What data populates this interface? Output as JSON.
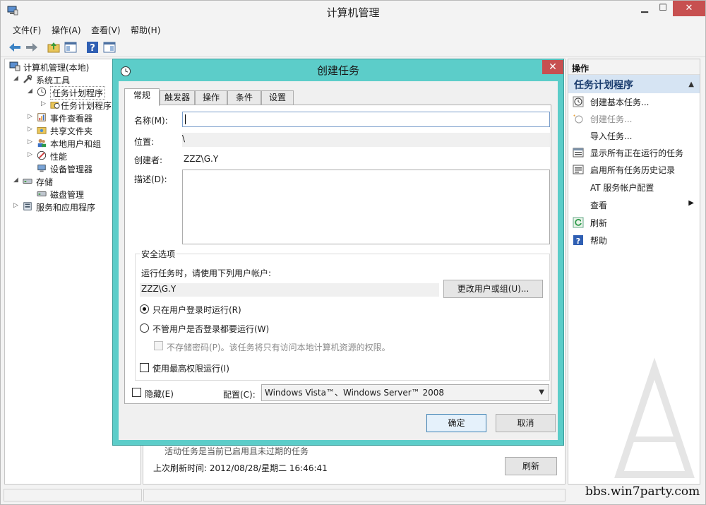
{
  "window": {
    "title": "计算机管理"
  },
  "menu": [
    "文件(F)",
    "操作(A)",
    "查看(V)",
    "帮助(H)"
  ],
  "tree": {
    "items": [
      {
        "label": "计算机管理(本地)",
        "arrow": "",
        "level": 0
      },
      {
        "label": "系统工具",
        "arrow": "◢",
        "level": 1
      },
      {
        "label": "任务计划程序",
        "arrow": "◢",
        "level": 2
      },
      {
        "label": "任务计划程序",
        "arrow": "▷",
        "level": 3
      },
      {
        "label": "事件查看器",
        "arrow": "▷",
        "level": 2
      },
      {
        "label": "共享文件夹",
        "arrow": "▷",
        "level": 2
      },
      {
        "label": "本地用户和组",
        "arrow": "▷",
        "level": 2
      },
      {
        "label": "性能",
        "arrow": "▷",
        "level": 2
      },
      {
        "label": "设备管理器",
        "arrow": "",
        "level": 2
      },
      {
        "label": "存储",
        "arrow": "◢",
        "level": 1
      },
      {
        "label": "磁盘管理",
        "arrow": "",
        "level": 2
      },
      {
        "label": "服务和应用程序",
        "arrow": "▷",
        "level": 1
      }
    ]
  },
  "center": {
    "obscured_text": "活动任务是当前已启用且未过期的任务",
    "last_refresh": "上次刷新时间: 2012/08/28/星期二 16:46:41",
    "refresh_button": "刷新"
  },
  "actions": {
    "header": "操作",
    "section": "任务计划程序",
    "items": [
      {
        "label": "创建基本任务...",
        "disabled": false
      },
      {
        "label": "创建任务...",
        "disabled": true
      },
      {
        "label": "导入任务...",
        "disabled": false
      },
      {
        "label": "显示所有正在运行的任务",
        "disabled": false
      },
      {
        "label": "启用所有任务历史记录",
        "disabled": false
      },
      {
        "label": "AT 服务帐户配置",
        "disabled": false
      },
      {
        "label": "查看",
        "disabled": false
      },
      {
        "label": "刷新",
        "disabled": false
      },
      {
        "label": "帮助",
        "disabled": false
      }
    ]
  },
  "dialog": {
    "title": "创建任务",
    "tabs": [
      "常规",
      "触发器",
      "操作",
      "条件",
      "设置"
    ],
    "name_label": "名称(M):",
    "name_value": "",
    "location_label": "位置:",
    "location_value": "\\",
    "author_label": "创建者:",
    "author_value": "ZZZ\\G.Y",
    "description_label": "描述(D):",
    "security": {
      "title": "安全选项",
      "prompt": "运行任务时，请使用下列用户帐户:",
      "account": "ZZZ\\G.Y",
      "change_button": "更改用户或组(U)...",
      "radio_logged_on": "只在用户登录时运行(R)",
      "radio_always": "不管用户是否登录都要运行(W)",
      "no_store_password": "不存储密码(P)。该任务将只有访问本地计算机资源的权限。",
      "highest_priv": "使用最高权限运行(I)"
    },
    "hidden_label": "隐藏(E)",
    "config_label": "配置(C):",
    "config_value": "Windows Vista™、Windows Server™ 2008",
    "ok": "确定",
    "cancel": "取消"
  },
  "watermark": "bbs.win7party.com"
}
